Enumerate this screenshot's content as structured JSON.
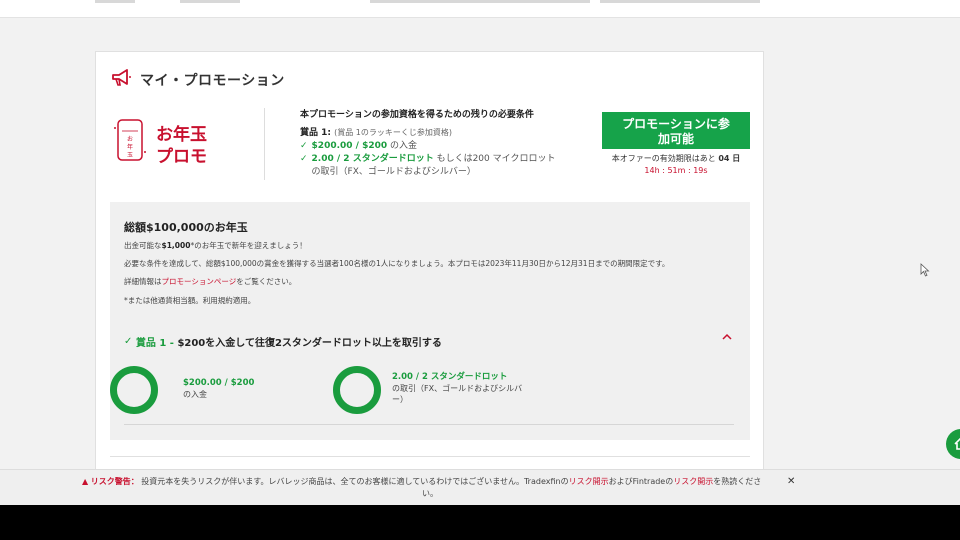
{
  "card": {
    "title": "マイ・プロモーション"
  },
  "logo": {
    "text_line1": "お年玉",
    "text_line2": "プロモ",
    "badge_text": "お年玉"
  },
  "requirements": {
    "heading": "本プロモーションの参加資格を得るための残りの必要条件",
    "prize_label": "賞品 1:",
    "prize_sub": "(賞品 1のラッキーくじ参加資格)",
    "cond1_value": "$200.00 / $200",
    "cond1_suffix": "の入金",
    "cond2_value": "2.00 / 2 スタンダードロット",
    "cond2_suffix": "もしくは200 マイクロロット",
    "cond2_line2": "の取引（FX、ゴールドおよびシルバー）"
  },
  "promo_button": {
    "label_line1": "プロモーションに参",
    "label_line2": "加可能"
  },
  "expiry": {
    "text": "本オファーの有効期限はあと",
    "days": "04 日",
    "countdown": "14h : 51m : 19s"
  },
  "panel": {
    "title": "総額$100,000のお年玉",
    "line1_pre": "出金可能な",
    "line1_bold": "$1,000",
    "line1_post": "*のお年玉で新年を迎えましょう！",
    "line2": "必要な条件を達成して、総額$100,000の賞金を獲得する当選者100名様の1人になりましょう。本プロモは2023年11月30日から12月31日までの期間限定です。",
    "line3_pre": "詳細情報は",
    "line3_link": "プロモーションページ",
    "line3_post": "をご覧ください。",
    "line4": "*または他通貨相当額。利用規約適用。",
    "prize_title_green": "賞品 1 -",
    "prize_title": "$200を入金して往復2スタンダードロット以上を取引する",
    "progress1_value": "$200.00 / $200",
    "progress1_label": "の入金",
    "progress1_fraction": 1.0,
    "progress2_value": "2.00 / 2 スタンダードロット",
    "progress2_label_line1": "の取引（FX、ゴールドおよびシルバ",
    "progress2_label_line2": "ー）",
    "progress2_fraction": 1.0
  },
  "risk_bar": {
    "warning": "リスク警告：",
    "text": "投資元本を失うリスクが伴います。レバレッジ商品は、全てのお客様に適しているわけではございません。Tradexfinの",
    "link1": "リスク開示",
    "mid": "およびFintradeの",
    "link2": "リスク開示",
    "end": "を熟読くださ",
    "end_line2": "い。",
    "close": "✕"
  },
  "colors": {
    "accent_green": "#1a9c3e",
    "button_green": "#16a34a",
    "brand_red": "#c8102e",
    "panel_bg": "#f0f0f0"
  },
  "icons": [
    "megaphone-icon",
    "check-icon",
    "chevron-up-icon",
    "warning-icon",
    "close-icon",
    "cursor-icon"
  ]
}
